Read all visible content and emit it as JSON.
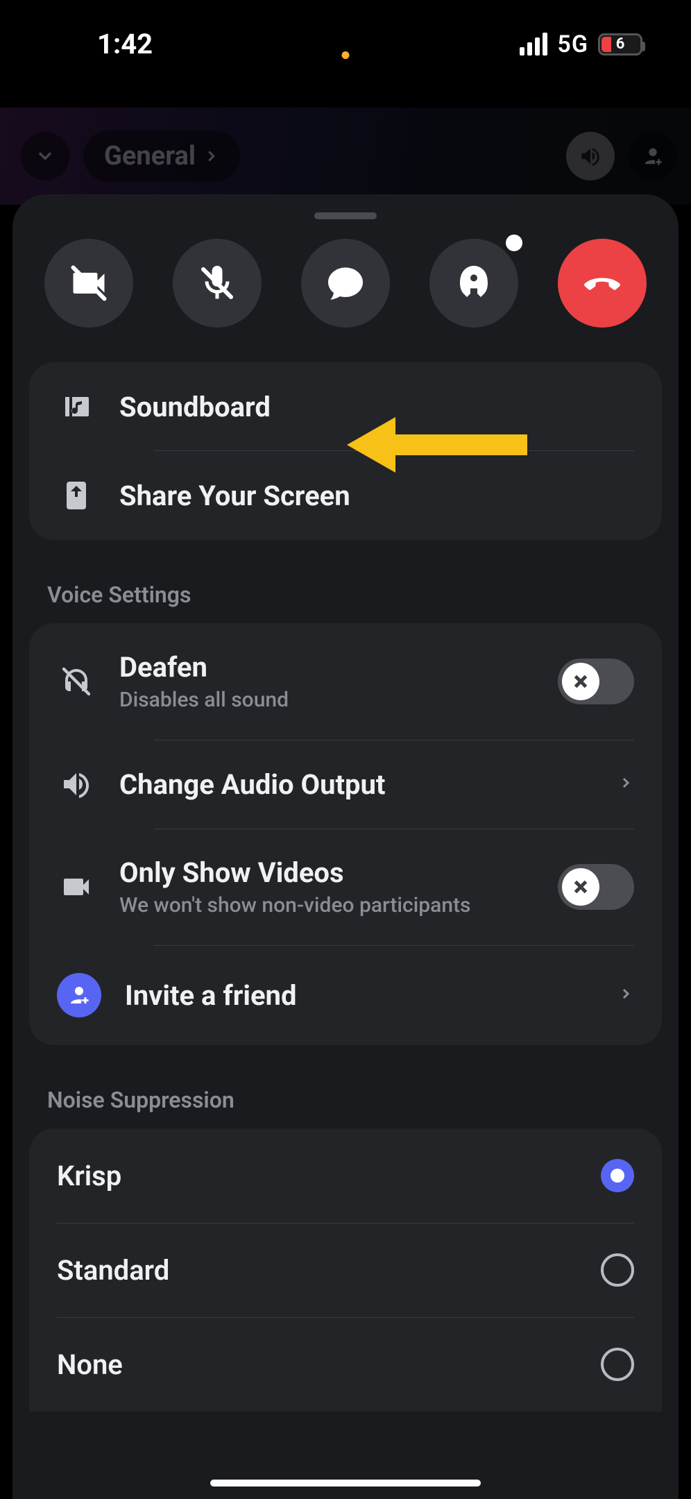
{
  "status": {
    "time": "1:42",
    "network": "5G",
    "battery_pct": "6"
  },
  "header": {
    "channel": "General"
  },
  "quick": {
    "soundboard": "Soundboard",
    "share_screen": "Share Your Screen"
  },
  "sections": {
    "voice_settings_label": "Voice Settings",
    "noise_suppression_label": "Noise Suppression"
  },
  "voice": {
    "deafen": {
      "title": "Deafen",
      "sub": "Disables all sound"
    },
    "audio_output": {
      "title": "Change Audio Output"
    },
    "only_videos": {
      "title": "Only Show Videos",
      "sub": "We won't show non-video participants"
    },
    "invite": {
      "title": "Invite a friend"
    }
  },
  "noise": {
    "krisp": "Krisp",
    "standard": "Standard",
    "none": "None",
    "selected": "krisp"
  }
}
